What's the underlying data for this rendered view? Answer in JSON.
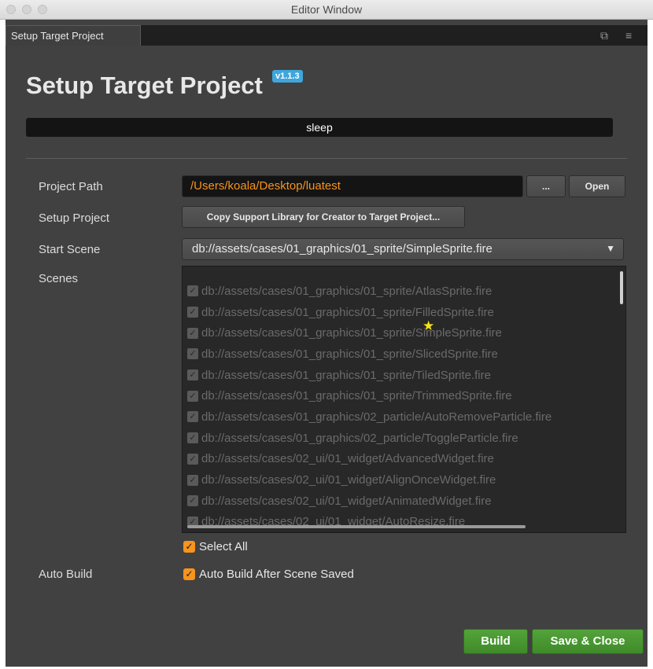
{
  "window": {
    "title": "Editor Window"
  },
  "tab": {
    "label": "Setup Target Project",
    "popout_icon": "popout-icon",
    "menu_icon": "menu-icon"
  },
  "heading": {
    "title": "Setup Target Project",
    "version": "v1.1.3"
  },
  "status": {
    "text": "sleep"
  },
  "form": {
    "project_path": {
      "label": "Project Path",
      "value": "/Users/koala/Desktop/luatest",
      "browse_label": "...",
      "open_label": "Open"
    },
    "setup_project": {
      "label": "Setup Project",
      "button_label": "Copy Support Library for Creator to Target Project..."
    },
    "start_scene": {
      "label": "Start Scene",
      "value": "db://assets/cases/01_graphics/01_sprite/SimpleSprite.fire",
      "arrow": "▼"
    },
    "scenes": {
      "label": "Scenes",
      "items": [
        "db://assets/cases/01_graphics/01_sprite/AtlasSprite.fire",
        "db://assets/cases/01_graphics/01_sprite/FilledSprite.fire",
        "db://assets/cases/01_graphics/01_sprite/SimpleSprite.fire",
        "db://assets/cases/01_graphics/01_sprite/SlicedSprite.fire",
        "db://assets/cases/01_graphics/01_sprite/TiledSprite.fire",
        "db://assets/cases/01_graphics/01_sprite/TrimmedSprite.fire",
        "db://assets/cases/01_graphics/02_particle/AutoRemoveParticle.fire",
        "db://assets/cases/01_graphics/02_particle/ToggleParticle.fire",
        "db://assets/cases/02_ui/01_widget/AdvancedWidget.fire",
        "db://assets/cases/02_ui/01_widget/AlignOnceWidget.fire",
        "db://assets/cases/02_ui/01_widget/AnimatedWidget.fire",
        "db://assets/cases/02_ui/01_widget/AutoResize.fire"
      ],
      "start_scene_marker": "★",
      "select_all_label": "Select All",
      "select_all_checked": true
    },
    "auto_build": {
      "label": "Auto Build",
      "checkbox_label": "Auto Build After Scene Saved",
      "checked": true
    }
  },
  "buttons": {
    "build": "Build",
    "save_close": "Save & Close"
  },
  "colors": {
    "accent_orange": "#f7941d",
    "badge_blue": "#3fa6db",
    "button_green": "#4a9a34",
    "panel_bg": "#414141",
    "star_yellow": "#f7e21a"
  }
}
